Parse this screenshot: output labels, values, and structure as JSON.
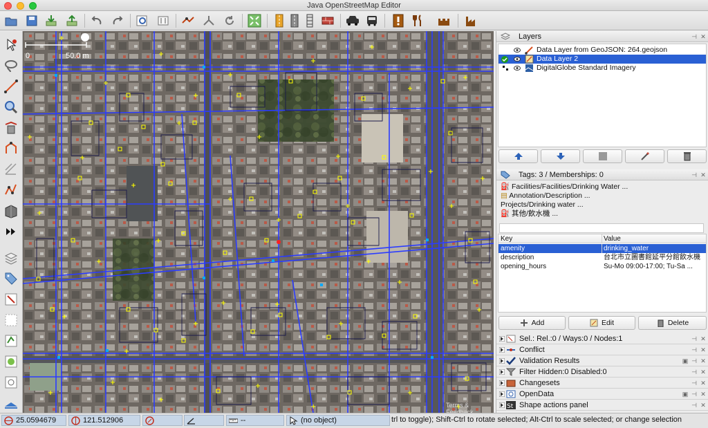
{
  "window": {
    "title": "Java OpenStreetMap Editor"
  },
  "map": {
    "scale_start": "0",
    "scale_label": "50.0 m",
    "attribution": "Terms & Feedback"
  },
  "layers_panel": {
    "title": "Layers",
    "items": [
      {
        "name": "Data Layer from GeoJSON: 264.geojson",
        "active": false,
        "visible": true
      },
      {
        "name": "Data Layer 2",
        "active": true,
        "visible": true
      },
      {
        "name": "DigitalGlobe Standard Imagery",
        "active": false,
        "visible": true
      }
    ]
  },
  "tags_panel": {
    "title": "Tags: 3 / Memberships: 0",
    "presets": [
      "Facilities/Facilities/Drinking Water ...",
      "Annotation/Description ...",
      "Projects/Drinking water ...",
      "其他/飲水機 ..."
    ],
    "col_key": "Key",
    "col_value": "Value",
    "rows": [
      {
        "key": "amenity",
        "value": "drinking_water"
      },
      {
        "key": "description",
        "value": "台北市立圖書館延平分館飲水機"
      },
      {
        "key": "opening_hours",
        "value": "Su-Mo 09:00-17:00; Tu-Sa ..."
      }
    ],
    "add_label": "Add",
    "edit_label": "Edit",
    "delete_label": "Delete"
  },
  "collapsed_panels": [
    {
      "label": "Sel.: Rel.:0 / Ways:0 / Nodes:1",
      "icon": "selection-icon"
    },
    {
      "label": "Conflict",
      "icon": "conflict-icon"
    },
    {
      "label": "Validation Results",
      "icon": "validation-icon"
    },
    {
      "label": "Filter Hidden:0 Disabled:0",
      "icon": "filter-icon"
    },
    {
      "label": "Changesets",
      "icon": "changesets-icon"
    },
    {
      "label": "OpenData",
      "icon": "opendata-icon"
    },
    {
      "label": "Shape actions panel",
      "icon": "shape-actions-icon"
    }
  ],
  "statusbar": {
    "lat": "25.0594679",
    "lon": "121.512906",
    "heading": "",
    "angle": "",
    "distance": "--",
    "object": "(no object)",
    "help": "trl to toggle); Shift-Ctrl to rotate selected; Alt-Ctrl to scale selected; or change selection"
  },
  "colors": {
    "selection_blue": "#2a60d4",
    "way_blue": "#2b3cff",
    "node_yellow": "#ffff00",
    "status_field": "#c7d6e7"
  }
}
